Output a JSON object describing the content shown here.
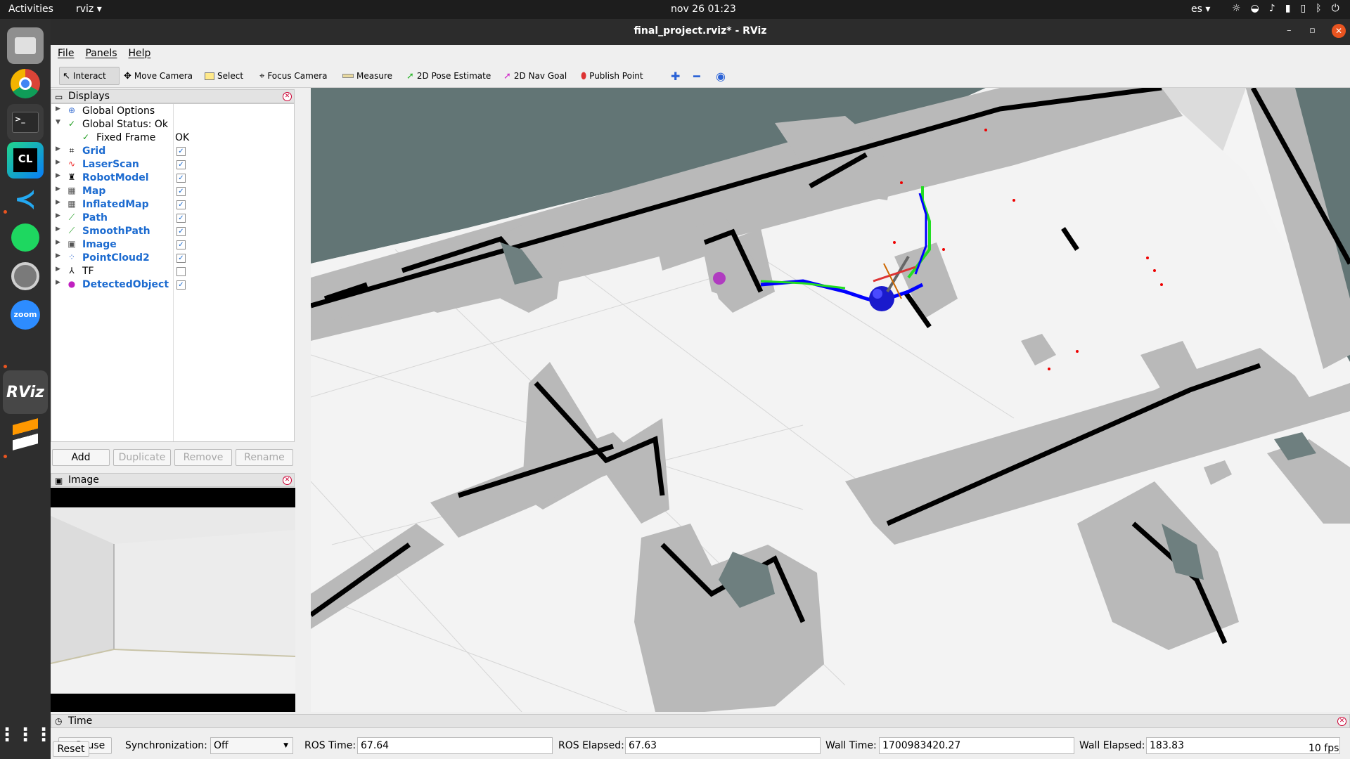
{
  "topbar": {
    "activities": "Activities",
    "app_name": "rviz ▾",
    "clock": "nov 26  01:23",
    "lang": "es ▾"
  },
  "dock": {
    "items": [
      {
        "name": "files",
        "label": ""
      },
      {
        "name": "chrome",
        "label": ""
      },
      {
        "name": "terminal",
        "label": ">_"
      },
      {
        "name": "clion",
        "label": "CL"
      },
      {
        "name": "vscode",
        "label": ""
      },
      {
        "name": "spotify",
        "label": ""
      },
      {
        "name": "settings",
        "label": ""
      },
      {
        "name": "zoom",
        "label": "zoom"
      },
      {
        "name": "rviz",
        "label": "RViz"
      },
      {
        "name": "sublime",
        "label": ""
      }
    ]
  },
  "window": {
    "title": "final_project.rviz* - RViz"
  },
  "menu": {
    "file": "File",
    "panels": "Panels",
    "help": "Help"
  },
  "toolbar": {
    "interact": "Interact",
    "move_camera": "Move Camera",
    "select": "Select",
    "focus_camera": "Focus Camera",
    "measure": "Measure",
    "pose_estimate": "2D Pose Estimate",
    "nav_goal": "2D Nav Goal",
    "publish_point": "Publish Point"
  },
  "displays": {
    "title": "Displays",
    "items": [
      {
        "label": "Global Options",
        "checked": null
      },
      {
        "label": "Global Status: Ok",
        "checked": null
      },
      {
        "label": "Fixed Frame",
        "value": "OK"
      },
      {
        "label": "Grid",
        "checked": true
      },
      {
        "label": "LaserScan",
        "checked": true
      },
      {
        "label": "RobotModel",
        "checked": true
      },
      {
        "label": "Map",
        "checked": true
      },
      {
        "label": "InflatedMap",
        "checked": true
      },
      {
        "label": "Path",
        "checked": true
      },
      {
        "label": "SmoothPath",
        "checked": true
      },
      {
        "label": "Image",
        "checked": true
      },
      {
        "label": "PointCloud2",
        "checked": true
      },
      {
        "label": "TF",
        "checked": false
      },
      {
        "label": "DetectedObject",
        "checked": true
      }
    ],
    "buttons": {
      "add": "Add",
      "duplicate": "Duplicate",
      "remove": "Remove",
      "rename": "Rename"
    }
  },
  "image_panel": {
    "title": "Image"
  },
  "time": {
    "title": "Time",
    "pause": "Pause",
    "sync_label": "Synchronization:",
    "sync_value": "Off",
    "ros_time_label": "ROS Time:",
    "ros_time": "67.64",
    "ros_elapsed_label": "ROS Elapsed:",
    "ros_elapsed": "67.63",
    "wall_time_label": "Wall Time:",
    "wall_time": "1700983420.27",
    "wall_elapsed_label": "Wall Elapsed:",
    "wall_elapsed": "183.83",
    "reset": "Reset",
    "fps": "10 fps"
  },
  "colors": {
    "accent": "#e95420",
    "display_blue": "#1c6bd0",
    "path_blue": "#0000ff",
    "path_green": "#22dd22"
  }
}
